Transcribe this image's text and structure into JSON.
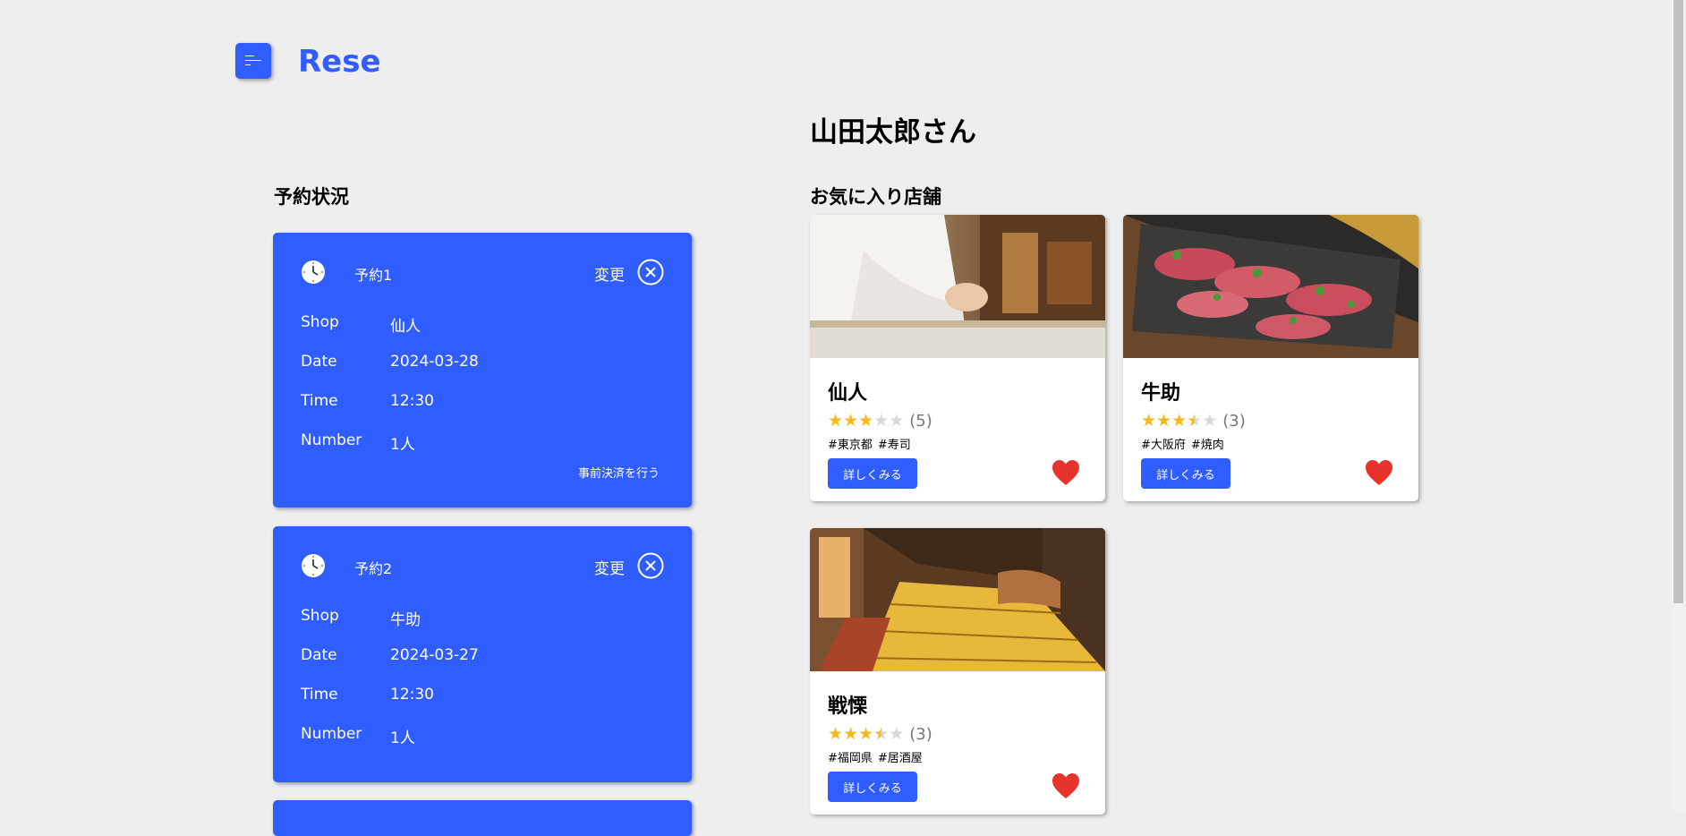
{
  "header": {
    "logo": "Rese",
    "menu_icon": "menu-icon"
  },
  "user": {
    "greeting": "山田太郎さん"
  },
  "reservations": {
    "title": "予約状況",
    "items": [
      {
        "label": "予約1",
        "change_label": "変更",
        "rows": [
          {
            "key": "Shop",
            "value": "仙人"
          },
          {
            "key": "Date",
            "value": "2024-03-28"
          },
          {
            "key": "Time",
            "value": "12:30"
          },
          {
            "key": "Number",
            "value": "1人"
          }
        ],
        "prepay_label": "事前決済を行う"
      },
      {
        "label": "予約2",
        "change_label": "変更",
        "rows": [
          {
            "key": "Shop",
            "value": "牛助"
          },
          {
            "key": "Date",
            "value": "2024-03-27"
          },
          {
            "key": "Time",
            "value": "12:30"
          },
          {
            "key": "Number",
            "value": "1人"
          }
        ]
      }
    ]
  },
  "favorites": {
    "title": "お気に入り店舗",
    "shops": [
      {
        "name": "仙人",
        "rating": 3,
        "count": "(5)",
        "tags": [
          "#東京都",
          "#寿司"
        ],
        "button": "詳しくみる",
        "favorited": true
      },
      {
        "name": "牛助",
        "rating": 3.5,
        "count": "(3)",
        "tags": [
          "#大阪府",
          "#焼肉"
        ],
        "button": "詳しくみる",
        "favorited": true
      },
      {
        "name": "戦慄",
        "rating": 3.5,
        "count": "(3)",
        "tags": [
          "#福岡県",
          "#居酒屋"
        ],
        "button": "詳しくみる",
        "favorited": true
      }
    ]
  },
  "colors": {
    "accent": "#305dff",
    "heart": "#e8332c",
    "star": "#f6b81e",
    "background": "#eeeeee"
  }
}
